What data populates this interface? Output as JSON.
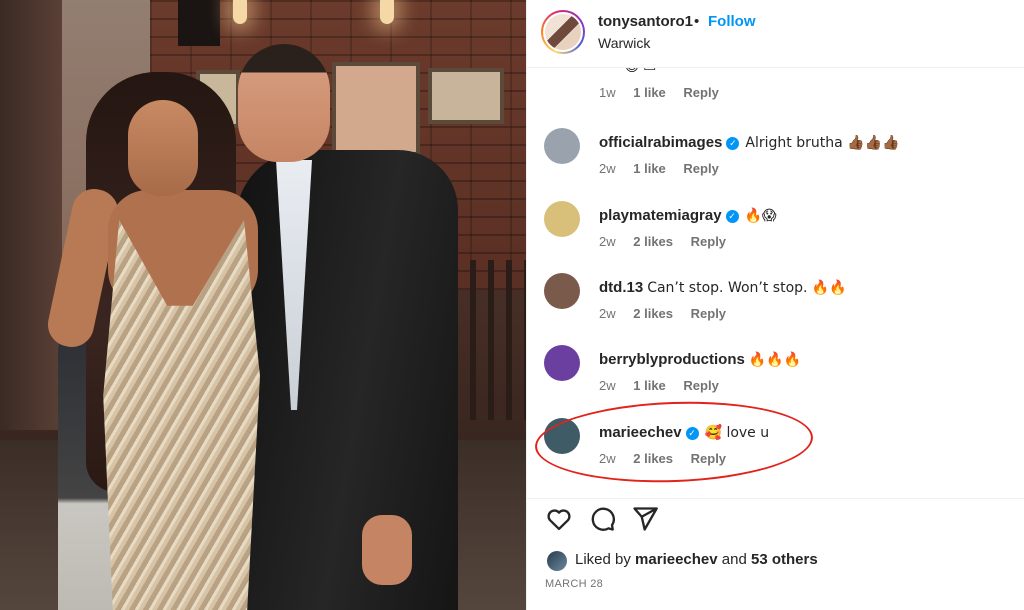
{
  "post": {
    "username": "tonysantoro1",
    "separator": "•",
    "follow_label": "Follow",
    "location": "Warwick"
  },
  "comments": [
    {
      "username": "",
      "text": "",
      "age": "1w",
      "likes": "1 like",
      "reply": "Reply",
      "partial": true
    },
    {
      "username": "officialrabimages",
      "verified": true,
      "text": "Alright brutha 👍🏾👍🏾👍🏾",
      "age": "2w",
      "likes": "1 like",
      "reply": "Reply",
      "avatar_color": "#9aa3ad"
    },
    {
      "username": "playmatemiagray",
      "verified": true,
      "text": "🔥😱",
      "age": "2w",
      "likes": "2 likes",
      "reply": "Reply",
      "avatar_color": "#d8c07a"
    },
    {
      "username": "dtd.13",
      "verified": false,
      "text": "Can’t stop. Won’t stop. 🔥🔥",
      "age": "2w",
      "likes": "2 likes",
      "reply": "Reply",
      "avatar_color": "#7a5a4a"
    },
    {
      "username": "berryblyproductions",
      "verified": false,
      "text": "🔥🔥🔥",
      "age": "2w",
      "likes": "1 like",
      "reply": "Reply",
      "avatar_color": "#6a3fa0"
    },
    {
      "username": "marieechev",
      "verified": true,
      "text": "🥰 love u",
      "age": "2w",
      "likes": "2 likes",
      "reply": "Reply",
      "avatar_color": "#3f5b66"
    }
  ],
  "actions": {
    "like_icon": "heart-icon",
    "comment_icon": "comment-bubble-icon",
    "share_icon": "paper-plane-icon"
  },
  "likes_summary": {
    "prefix": "Liked by",
    "user": "marieechev",
    "and": "and",
    "others": "53 others"
  },
  "date": "MARCH 28",
  "colors": {
    "follow": "#0095f6",
    "verified": "#0095f6",
    "highlight_circle": "#e2231a"
  }
}
